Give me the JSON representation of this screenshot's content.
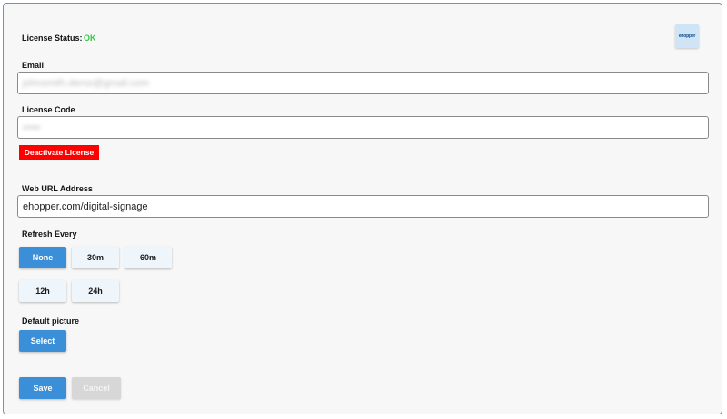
{
  "license": {
    "status_label": "License Status:",
    "status_value": "OK",
    "logo_text": "ehopper"
  },
  "email": {
    "label": "Email",
    "value": "johnsmith.demo@gmail.com"
  },
  "license_code": {
    "label": "License Code",
    "value": "•••••",
    "deactivate_label": "Deactivate License"
  },
  "web_url": {
    "label": "Web URL Address",
    "value": "ehopper.com/digital-signage"
  },
  "refresh": {
    "label": "Refresh Every",
    "options": [
      "None",
      "30m",
      "60m",
      "12h",
      "24h"
    ],
    "selected": "None"
  },
  "default_picture": {
    "label": "Default picture",
    "select_label": "Select"
  },
  "actions": {
    "save_label": "Save",
    "cancel_label": "Cancel"
  },
  "colors": {
    "accent": "#3a8fd8",
    "ok": "#2ecc40",
    "danger": "#ff0000",
    "border": "#5b9bd5"
  }
}
